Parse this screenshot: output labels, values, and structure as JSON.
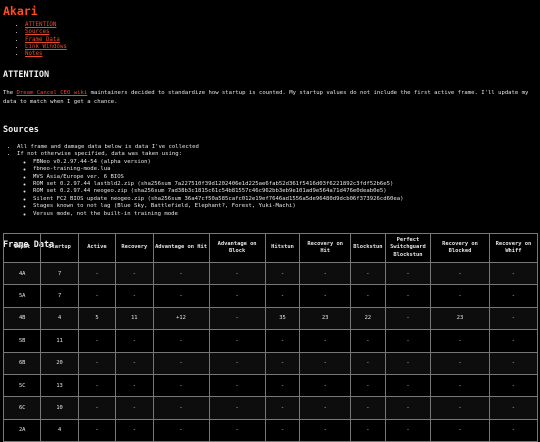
{
  "site_title": "Akari",
  "toc": [
    "ATTENTION",
    "Sources",
    "Frame Data",
    "Link Windows",
    "Notes"
  ],
  "attention": {
    "heading": "ATTENTION",
    "text_before": "The ",
    "link": "Dream Cancel CEO wiki",
    "text_after": " maintainers decided to standardize how startup is counted. My startup values do not include the first active frame. I'll update my data to match when I get a chance."
  },
  "sources": {
    "heading": "Sources",
    "items": [
      "All frame and damage data below is data I've collected",
      "If not otherwise specified, data was taken using:"
    ],
    "sub_items": [
      "FBNeo v0.2.97.44-54 (alpha version)",
      "fbneo-training-mode.lua",
      "MVS Asia/Europe ver. 6 BIOS",
      "ROM set 0.2.97.44 lastbld2.zip (sha256sum 7a227510f39d1202406e1d225ae6fab52d361f5416d03f6221892c3fdf52b6e5)",
      "ROM set 0.2.97.44 neogeo.zip (sha256sum 7ad38b3c1815c61c54b81557c46c962bb3eb9e101ad9e564a71d476e0deab0e5)",
      "Silent FC2 BIOS update neogeo.zip (sha256sum 36a47cf50a585cafc012e19ef7646ad1556a5de96480d9dcb06f373926cd60ea)",
      "Stages known to not lag (Blue Sky, Battlefield, Elephant?, Forest, Yuki-Machi)",
      "Versus mode, not the built-in training mode"
    ]
  },
  "frame_data": {
    "heading": "Frame Data",
    "columns": [
      "Input",
      "Startup",
      "Active",
      "Recovery",
      "Advantage on Hit",
      "Advantage on Block",
      "Hitstun",
      "Recovery on Hit",
      "Blockstun",
      "Perfect Switchguard Blockstun",
      "Recovery on Blocked",
      "Recovery on Whiff"
    ],
    "rows": [
      [
        "4A",
        "7",
        "-",
        "-",
        "-",
        "-",
        "-",
        "-",
        "-",
        "-",
        "-",
        "-"
      ],
      [
        "5A",
        "7",
        "-",
        "-",
        "-",
        "-",
        "-",
        "-",
        "-",
        "-",
        "-",
        "-"
      ],
      [
        "4B",
        "4",
        "5",
        "11",
        "+12",
        "-",
        "35",
        "23",
        "22",
        "-",
        "23",
        "-"
      ],
      [
        "5B",
        "11",
        "-",
        "-",
        "-",
        "-",
        "-",
        "-",
        "-",
        "-",
        "-",
        "-"
      ],
      [
        "6B",
        "20",
        "-",
        "-",
        "-",
        "-",
        "-",
        "-",
        "-",
        "-",
        "-",
        "-"
      ],
      [
        "5C",
        "13",
        "-",
        "-",
        "-",
        "-",
        "-",
        "-",
        "-",
        "-",
        "-",
        "-"
      ],
      [
        "6C",
        "10",
        "-",
        "-",
        "-",
        "-",
        "-",
        "-",
        "-",
        "-",
        "-",
        "-"
      ],
      [
        "2A",
        "4",
        "-",
        "-",
        "-",
        "-",
        "-",
        "-",
        "-",
        "-",
        "-",
        "-"
      ]
    ]
  },
  "colors": {
    "background": "#000000",
    "accent": "#ff4b1f",
    "link": "#e84a2a",
    "text": "#e6e6e6"
  }
}
